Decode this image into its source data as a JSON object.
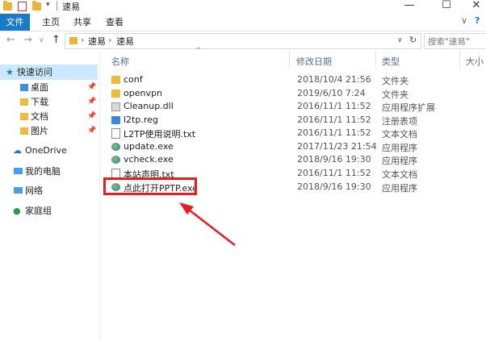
{
  "window": {
    "title": "速易",
    "minimize_glyph": "—",
    "maximize_glyph": "☐",
    "close_glyph": "✕"
  },
  "ribbon": {
    "tabs": [
      "文件",
      "主页",
      "共享",
      "查看"
    ],
    "collapse_glyph": "∨",
    "help_glyph": "?"
  },
  "address": {
    "back_glyph": "←",
    "forward_glyph": "→",
    "recent_glyph": "∨",
    "up_glyph": "↑",
    "breadcrumb": [
      "速易",
      "速易"
    ],
    "separator": "›",
    "dropdown_glyph": "∨",
    "refresh_glyph": "↻",
    "search_placeholder": "搜索\"速易\""
  },
  "nav": {
    "quick_access": "快速访问",
    "pinned": [
      {
        "label": "桌面",
        "icon": "desktop-icon"
      },
      {
        "label": "下载",
        "icon": "download-icon"
      },
      {
        "label": "文档",
        "icon": "document-icon"
      },
      {
        "label": "图片",
        "icon": "picture-icon"
      }
    ],
    "pin_glyph": "📌",
    "onedrive": "OneDrive",
    "this_pc": "我的电脑",
    "network": "网络",
    "homegroup": "家庭组"
  },
  "columns": {
    "name": "名称",
    "modified": "修改日期",
    "type": "类型",
    "size": "大小",
    "sort_glyph": "^"
  },
  "files": [
    {
      "name": "conf",
      "date": "2018/10/4 21:56",
      "type": "文件夹",
      "icon": "folder-icon"
    },
    {
      "name": "openvpn",
      "date": "2019/6/10 7:24",
      "type": "文件夹",
      "icon": "folder-icon"
    },
    {
      "name": "Cleanup.dll",
      "date": "2016/11/1 11:52",
      "type": "应用程序扩展",
      "icon": "dll-icon"
    },
    {
      "name": "l2tp.reg",
      "date": "2016/11/1 11:52",
      "type": "注册表项",
      "icon": "reg-icon"
    },
    {
      "name": "L2TP使用说明.txt",
      "date": "2016/11/1 11:52",
      "type": "文本文档",
      "icon": "text-file-icon"
    },
    {
      "name": "update.exe",
      "date": "2017/11/23 21:54",
      "type": "应用程序",
      "icon": "exe-icon"
    },
    {
      "name": "vcheck.exe",
      "date": "2018/9/16 19:30",
      "type": "应用程序",
      "icon": "exe-icon"
    },
    {
      "name": "本站声明.txt",
      "date": "2016/11/1 11:52",
      "type": "文本文档",
      "icon": "text-file-icon"
    },
    {
      "name": "点此打开PPTP.exe",
      "date": "2018/9/16 19:30",
      "type": "应用程序",
      "icon": "exe-icon"
    }
  ],
  "colors": {
    "accent": "#1979ca",
    "selection": "#cce8ff",
    "highlight_red": "#e51e25"
  }
}
